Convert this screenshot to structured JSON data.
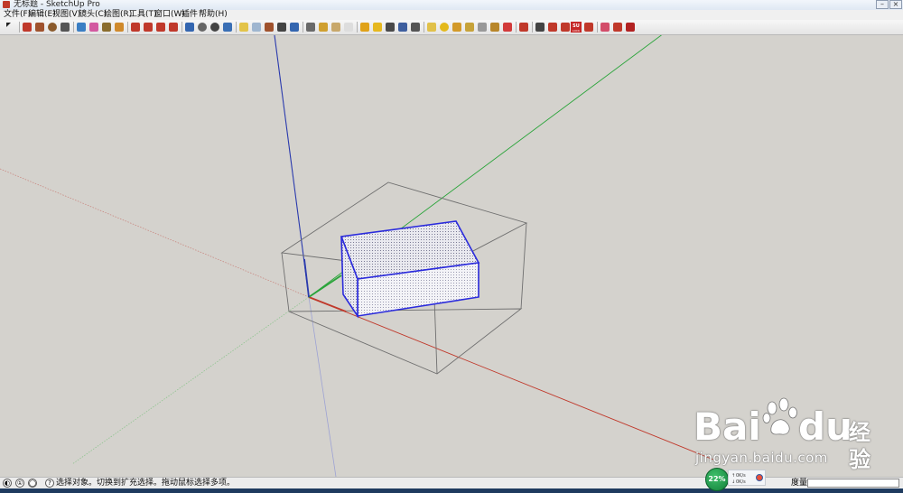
{
  "window": {
    "title": "无标题 - SketchUp Pro",
    "minimize_glyph": "–",
    "close_glyph": "×"
  },
  "menu": [
    "文件(F)",
    "编辑(E)",
    "视图(V)",
    "镜头(C)",
    "绘图(R)",
    "工具(T)",
    "窗口(W)",
    "插件",
    "帮助(H)"
  ],
  "toolbar": {
    "tools": [
      {
        "name": "select-tool",
        "icon": "arrow-cursor-icon",
        "color": "#222222"
      },
      {
        "name": "pencil-tool",
        "icon": "pencil-icon",
        "color": "#c0392b"
      },
      {
        "name": "rectangle-tool",
        "icon": "rectangle-icon",
        "color": "#a0522d"
      },
      {
        "name": "circle-tool",
        "icon": "circle-icon",
        "color": "#8b5a2b"
      },
      {
        "name": "arc-tool",
        "icon": "arc-icon",
        "color": "#555555"
      },
      {
        "name": "make-component-tool",
        "icon": "component-icon",
        "color": "#3b7fc4"
      },
      {
        "name": "eraser-tool",
        "icon": "eraser-icon",
        "color": "#d35aa0"
      },
      {
        "name": "tape-measure-tool",
        "icon": "tape-measure-icon",
        "color": "#8b6d2e"
      },
      {
        "name": "paint-bucket-tool",
        "icon": "paint-bucket-icon",
        "color": "#d08a2c"
      },
      {
        "name": "push-pull-tool",
        "icon": "push-pull-icon",
        "color": "#c0392b"
      },
      {
        "name": "move-tool",
        "icon": "move-icon",
        "color": "#c0392b"
      },
      {
        "name": "rotate-tool",
        "icon": "rotate-icon",
        "color": "#c0392b"
      },
      {
        "name": "follow-me-tool",
        "icon": "follow-me-icon",
        "color": "#c0392b"
      },
      {
        "name": "orbit-tool",
        "icon": "orbit-icon",
        "color": "#3466b0"
      },
      {
        "name": "pan-tool",
        "icon": "hand-icon",
        "color": "#666666"
      },
      {
        "name": "zoom-tool",
        "icon": "zoom-icon",
        "color": "#444444"
      },
      {
        "name": "zoom-extents-tool",
        "icon": "zoom-extents-icon",
        "color": "#3a6fb5"
      },
      {
        "name": "iso-view",
        "icon": "iso-view-icon",
        "color": "#e3c44a"
      },
      {
        "name": "top-view",
        "icon": "top-view-icon",
        "color": "#9fb6d0"
      },
      {
        "name": "front-view",
        "icon": "front-view-icon",
        "color": "#a0522d"
      },
      {
        "name": "right-view",
        "icon": "right-view-icon",
        "color": "#444444"
      },
      {
        "name": "back-view",
        "icon": "back-view-icon",
        "color": "#3466b0"
      },
      {
        "name": "xray-style",
        "icon": "xray-icon",
        "color": "#6a6a6a"
      },
      {
        "name": "wireframe-style",
        "icon": "wireframe-icon",
        "color": "#d0a030"
      },
      {
        "name": "hidden-line-style",
        "icon": "hidden-line-icon",
        "color": "#c8a86b"
      },
      {
        "name": "shaded-style",
        "icon": "shaded-icon",
        "color": "#dddddd"
      },
      {
        "name": "warehouse-get-models",
        "icon": "warehouse-icon",
        "color": "#e0a21a"
      },
      {
        "name": "share-model",
        "icon": "share-model-icon",
        "color": "#e6b820"
      },
      {
        "name": "component-warehouse",
        "icon": "component-warehouse-icon",
        "color": "#4a4a4a"
      },
      {
        "name": "photo-textures",
        "icon": "photo-texture-icon",
        "color": "#3f5f9f"
      },
      {
        "name": "extension-warehouse",
        "icon": "extension-icon",
        "color": "#555555"
      },
      {
        "name": "layer-tag",
        "icon": "tag-icon",
        "color": "#e1c14a"
      },
      {
        "name": "sphere-tool",
        "icon": "sphere-icon",
        "color": "#e4b91c"
      },
      {
        "name": "section-plane-tool",
        "icon": "section-icon",
        "color": "#d39a2a"
      },
      {
        "name": "axes-tool",
        "icon": "axes-icon",
        "color": "#c7a33a"
      },
      {
        "name": "dimension-tool",
        "icon": "dimension-icon",
        "color": "#999999"
      },
      {
        "name": "protractor-tool",
        "icon": "protractor-icon",
        "color": "#b8862a"
      },
      {
        "name": "text-tool",
        "icon": "text-icon",
        "color": "#d23b3b"
      },
      {
        "name": "shadow-settings",
        "icon": "shadow-icon",
        "color": "#c0392b"
      },
      {
        "name": "zoom-window-tool",
        "icon": "zoom-window-icon",
        "color": "#444444"
      },
      {
        "name": "look-around-tool",
        "icon": "look-around-icon",
        "color": "#c0392b"
      },
      {
        "name": "walk-tool",
        "icon": "walk-icon",
        "color": "#c0392b"
      },
      {
        "name": "position-camera-tool",
        "icon": "position-camera-icon",
        "color": "#c0392b"
      },
      {
        "name": "outliner-tool",
        "icon": "outliner-icon",
        "color": "#d34d6a"
      },
      {
        "name": "scenes-tool",
        "icon": "scenes-icon",
        "color": "#c0392b"
      },
      {
        "name": "ruby-console",
        "icon": "ruby-icon",
        "color": "#b22222"
      }
    ],
    "su_badge_top": "SU",
    "su_badge_bottom": "LOCK"
  },
  "viewport": {
    "axis_colors": {
      "red": "#c0392b",
      "green": "#2aa43a",
      "blue": "#2a3aad"
    },
    "selection_color": "#2b2bdc",
    "bounding_box_color": "#6f6f6f"
  },
  "statusbar": {
    "status_text": "选择对象。切换到扩充选择。拖动鼠标选择多项。",
    "measure_label": "度量",
    "measure_value": "",
    "icon_geo": "◐",
    "icon_credit": "①",
    "icon_user": "◯",
    "icon_help": "?"
  },
  "tray": {
    "cpu_percent": "22%",
    "up_label": "0K/s",
    "down_label": "0K/s",
    "up_arrow": "↑",
    "down_arrow": "↓"
  },
  "watermark": {
    "brand_left": "Bai",
    "brand_right": "du",
    "brand_cn": "经验",
    "url": "jingyan.baidu.com"
  }
}
